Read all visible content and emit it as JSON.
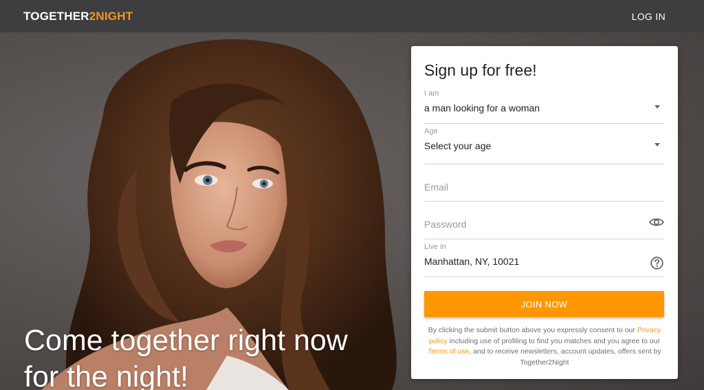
{
  "header": {
    "logo_part1": "TOGETHER",
    "logo_part2": "2NIGHT",
    "login_label": "LOG IN"
  },
  "hero": {
    "headline_line1": "Come together right now",
    "headline_line2": "for the night!"
  },
  "signup": {
    "title": "Sign up for free!",
    "iam_label": "I am",
    "iam_value": "a man looking for a woman",
    "age_label": "Age",
    "age_value": "Select your age",
    "email_placeholder": "Email",
    "password_placeholder": "Password",
    "livein_label": "Live in",
    "livein_value": "Manhattan, NY, 10021",
    "join_label": "JOIN NOW",
    "consent_part1": "By clicking the submit button above you expressly consent to our",
    "privacy_link": "Privacy policy",
    "consent_part2": "including use of profiling to find you matches and you agree to our",
    "terms_link": "Terms of use",
    "consent_part3": ", and to receive newsletters, account updates, offers sent by Together2Night"
  },
  "colors": {
    "accent": "#ff9800",
    "link": "#f7941d",
    "header_bg": "#3e3e40"
  }
}
